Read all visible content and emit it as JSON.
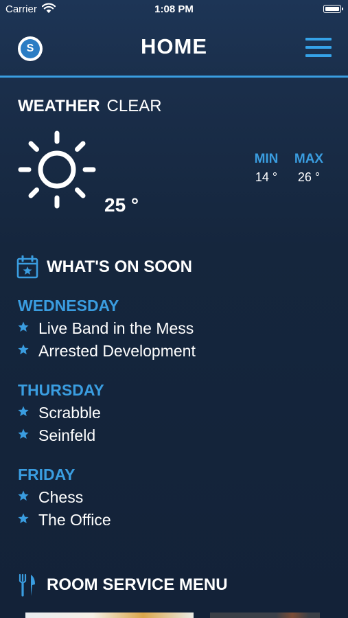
{
  "status_bar": {
    "carrier": "Carrier",
    "time": "1:08 PM"
  },
  "nav": {
    "logo_letter": "S",
    "title": "HOME"
  },
  "weather": {
    "label": "WEATHER",
    "condition": "CLEAR",
    "icon": "sun-icon",
    "temperature": "25 °",
    "min_label": "MIN",
    "min_value": "14 °",
    "max_label": "MAX",
    "max_value": "26 °"
  },
  "whats_on": {
    "title": "WHAT'S ON SOON",
    "icon": "calendar-icon",
    "days": [
      {
        "name": "WEDNESDAY",
        "events": [
          "Live Band in the Mess",
          "Arrested Development"
        ]
      },
      {
        "name": "THURSDAY",
        "events": [
          "Scrabble",
          "Seinfeld"
        ]
      },
      {
        "name": "FRIDAY",
        "events": [
          "Chess",
          "The Office"
        ]
      }
    ]
  },
  "room_service": {
    "title": "ROOM SERVICE MENU",
    "icon": "fork-knife-icon"
  },
  "colors": {
    "accent": "#3a9de0",
    "background": "#15263d",
    "text": "#ffffff"
  }
}
